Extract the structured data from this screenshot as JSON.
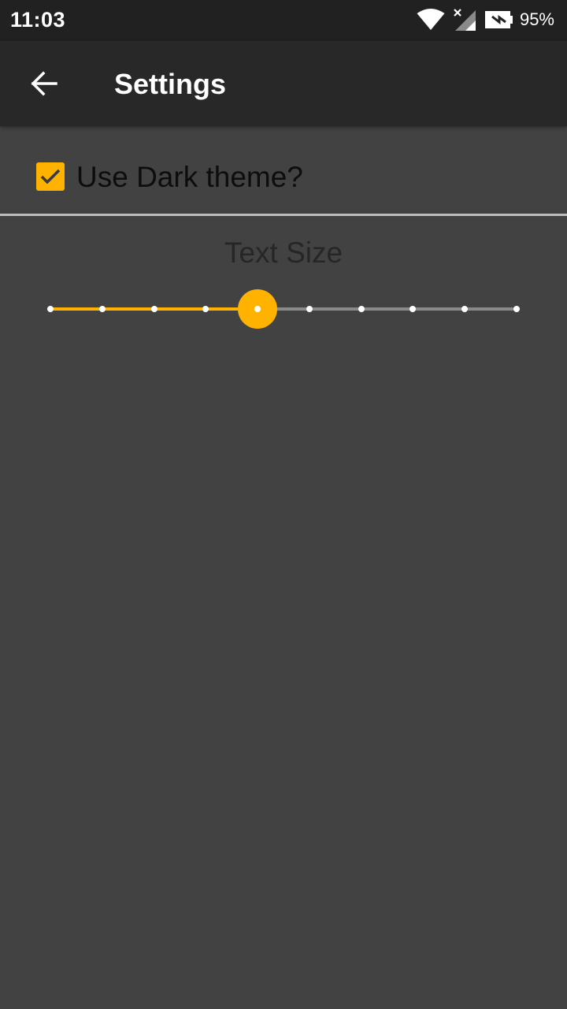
{
  "status_bar": {
    "time": "11:03",
    "battery": "95%",
    "icons": [
      "wifi-icon",
      "cell-signal-no-service-icon",
      "battery-charging-icon"
    ]
  },
  "app_bar": {
    "title": "Settings",
    "back_icon": "arrow-back-icon"
  },
  "settings": {
    "dark_theme": {
      "label": "Use Dark theme?",
      "checked": true
    },
    "text_size": {
      "label": "Text Size",
      "steps": 10,
      "selected_index": 4
    }
  },
  "colors": {
    "accent": "#ffb300",
    "background": "#424242",
    "app_bar": "#282828",
    "status_bar": "#212121"
  }
}
